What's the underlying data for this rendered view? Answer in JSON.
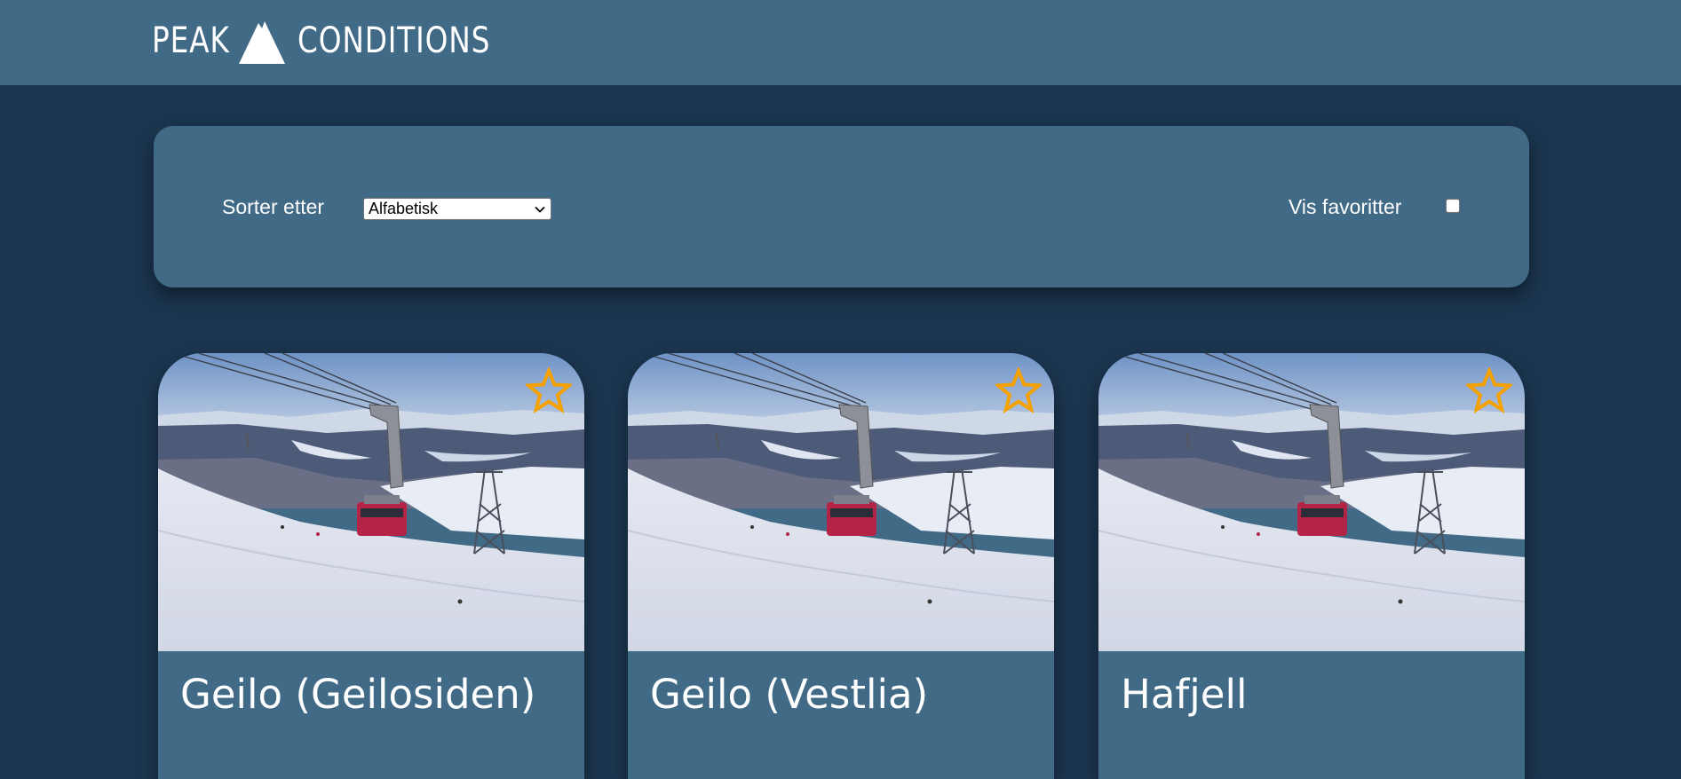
{
  "header": {
    "logo_first": "PEAK",
    "logo_second": "CONDITIONS"
  },
  "filters": {
    "sort_label": "Sorter etter",
    "sort_selected": "Alfabetisk",
    "favorites_label": "Vis favoritter",
    "favorites_checked": false
  },
  "resorts": [
    {
      "name": "Geilo (Geilosiden)",
      "favorite": false
    },
    {
      "name": "Geilo (Vestlia)",
      "favorite": false
    },
    {
      "name": "Hafjell",
      "favorite": false
    }
  ],
  "colors": {
    "background": "#1b3650",
    "panel": "#416a86",
    "star": "#f5a100"
  }
}
